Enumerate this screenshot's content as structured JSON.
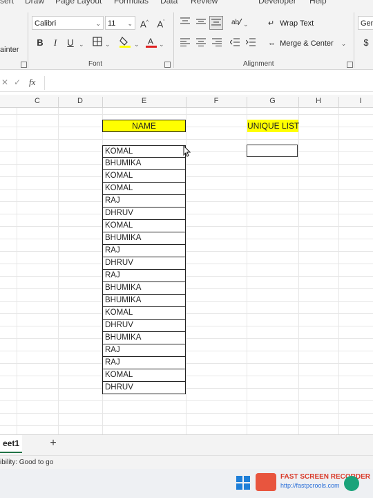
{
  "menu": [
    "sert",
    "Draw",
    "Page Layout",
    "Formulas",
    "Data",
    "Review",
    "Developer",
    "Help"
  ],
  "ribbon": {
    "painter_label": "ainter",
    "font_name": "Calibri",
    "font_size": "11",
    "font_group_label": "Font",
    "wrap_text_label": "Wrap Text",
    "merge_center_label": "Merge & Center",
    "alignment_group_label": "Alignment",
    "number_format": "Gen"
  },
  "formula_bar": {
    "fx_label": "fx",
    "value": ""
  },
  "columns": [
    "C",
    "D",
    "E",
    "F",
    "G",
    "H",
    "I"
  ],
  "sheet": {
    "name_header": "NAME",
    "unique_header": "UNIQUE LIST",
    "names": [
      "KOMAL",
      "BHUMIKA",
      "KOMAL",
      "KOMAL",
      "RAJ",
      "DHRUV",
      "KOMAL",
      "BHUMIKA",
      "RAJ",
      "DHRUV",
      "RAJ",
      "BHUMIKA",
      "BHUMIKA",
      "KOMAL",
      "DHRUV",
      "BHUMIKA",
      "RAJ",
      "RAJ",
      "KOMAL",
      "DHRUV"
    ],
    "header_color": "#ffff00"
  },
  "tabs": {
    "active": "eet1",
    "add_label": "+"
  },
  "status": {
    "accessibility": "ibility: Good to go"
  },
  "watermark": {
    "title": "FAST SCREEN RECORDER",
    "url": "http://fastpcrools.com"
  }
}
